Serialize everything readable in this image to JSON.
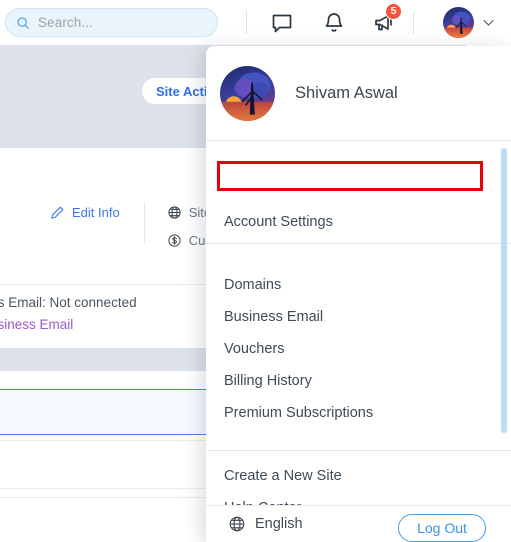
{
  "topbar": {
    "search": {
      "placeholder": "Search...",
      "icon": "search-icon"
    },
    "icons": {
      "chat": "chat-bubble-icon",
      "bell": "notification-bell-icon",
      "megaphone": "announcement-megaphone-icon",
      "chevron": "chevron-down-icon"
    },
    "notification_badge": "5",
    "avatar_alt": "user-avatar"
  },
  "background": {
    "site_actions_label": "Site Acti",
    "edit_info_label": "Edit Info",
    "edit_info_icon": "pencil-icon",
    "site_language_label": "Site la",
    "site_language_icon": "globe-icon",
    "currency_label": "Curre",
    "currency_icon": "dollar-coin-icon",
    "business_email_status": "ness Email: Not connected",
    "business_email_link": "Business Email"
  },
  "dropdown": {
    "user_name": "Shivam Aswal",
    "highlighted_item": "Account Settings",
    "items": [
      {
        "label": "Domains"
      },
      {
        "label": "Business Email"
      },
      {
        "label": "Vouchers"
      },
      {
        "label": "Billing History"
      },
      {
        "label": "Premium Subscriptions"
      }
    ],
    "secondary_items": [
      {
        "label": "Create a New Site"
      },
      {
        "label": "Help Center"
      }
    ],
    "footer": {
      "language": "English",
      "language_icon": "globe-icon",
      "logout_label": "Log Out"
    }
  },
  "colors": {
    "accent_blue": "#3d93df",
    "link_blue": "#2f6fe4",
    "badge_red": "#f4543c",
    "highlight_red": "#e8000d",
    "purple_link": "#9a5bc4",
    "scrollbar": "#bfdcf5"
  }
}
